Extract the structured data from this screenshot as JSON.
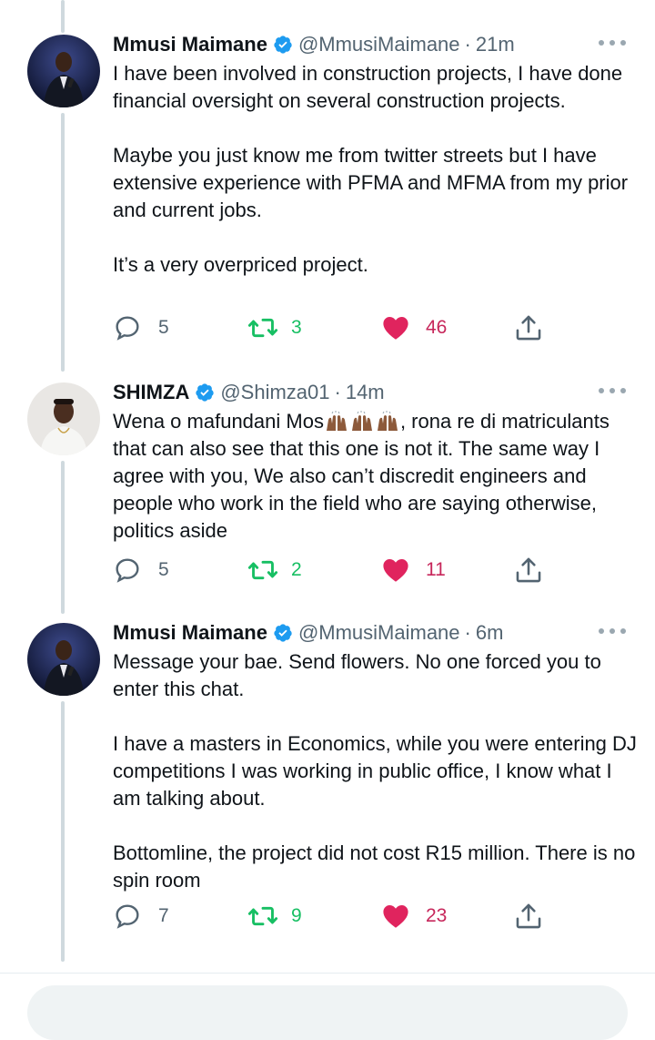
{
  "tweets": [
    {
      "name": "Mmusi Maimane",
      "handle": "@MmusiMaimane",
      "separator": "·",
      "time": "21m",
      "paragraphs": [
        "I have been involved in construction projects, I have done financial oversight on several construction projects.",
        "Maybe you just know me from twitter streets but I have extensive experience with PFMA and MFMA from my prior and current jobs.",
        "It’s a very overpriced project."
      ],
      "replies": "5",
      "retweets": "3",
      "likes": "46"
    },
    {
      "name": "SHIMZA",
      "handle": "@Shimza01",
      "separator": "·",
      "time": "14m",
      "text_before_emoji": "Wena o mafundani Mos",
      "emoji": [
        "raising-hands-emoji",
        "raising-hands-emoji",
        "raising-hands-emoji"
      ],
      "text_after_emoji": ", rona re di matriculants that can also see that this one is not it. The same way I agree with you, We also can’t discredit engineers and people who work in the field who are saying otherwise, politics aside",
      "replies": "5",
      "retweets": "2",
      "likes": "11"
    },
    {
      "name": "Mmusi Maimane",
      "handle": "@MmusiMaimane",
      "separator": "·",
      "time": "6m",
      "paragraphs": [
        "Message your bae. Send flowers. No one forced you to enter this chat.",
        "I have a masters in Economics, while you were entering DJ competitions I was working in public office, I know what I am talking about.",
        "Bottomline, the project did not cost R15 million. There is no spin room"
      ],
      "replies": "7",
      "retweets": "9",
      "likes": "23"
    }
  ],
  "icons": {
    "reply": "reply-icon",
    "retweet": "retweet-icon",
    "like": "heart-icon",
    "share": "share-icon",
    "verified": "verified-badge-icon",
    "more": "more-options-icon"
  },
  "colors": {
    "verified": "#1d9bf0",
    "retweet": "#17bf63",
    "like": "#e0245e",
    "like_count": "#c7275b",
    "secondary_text": "#536471",
    "thread_line": "#cfd9de"
  }
}
